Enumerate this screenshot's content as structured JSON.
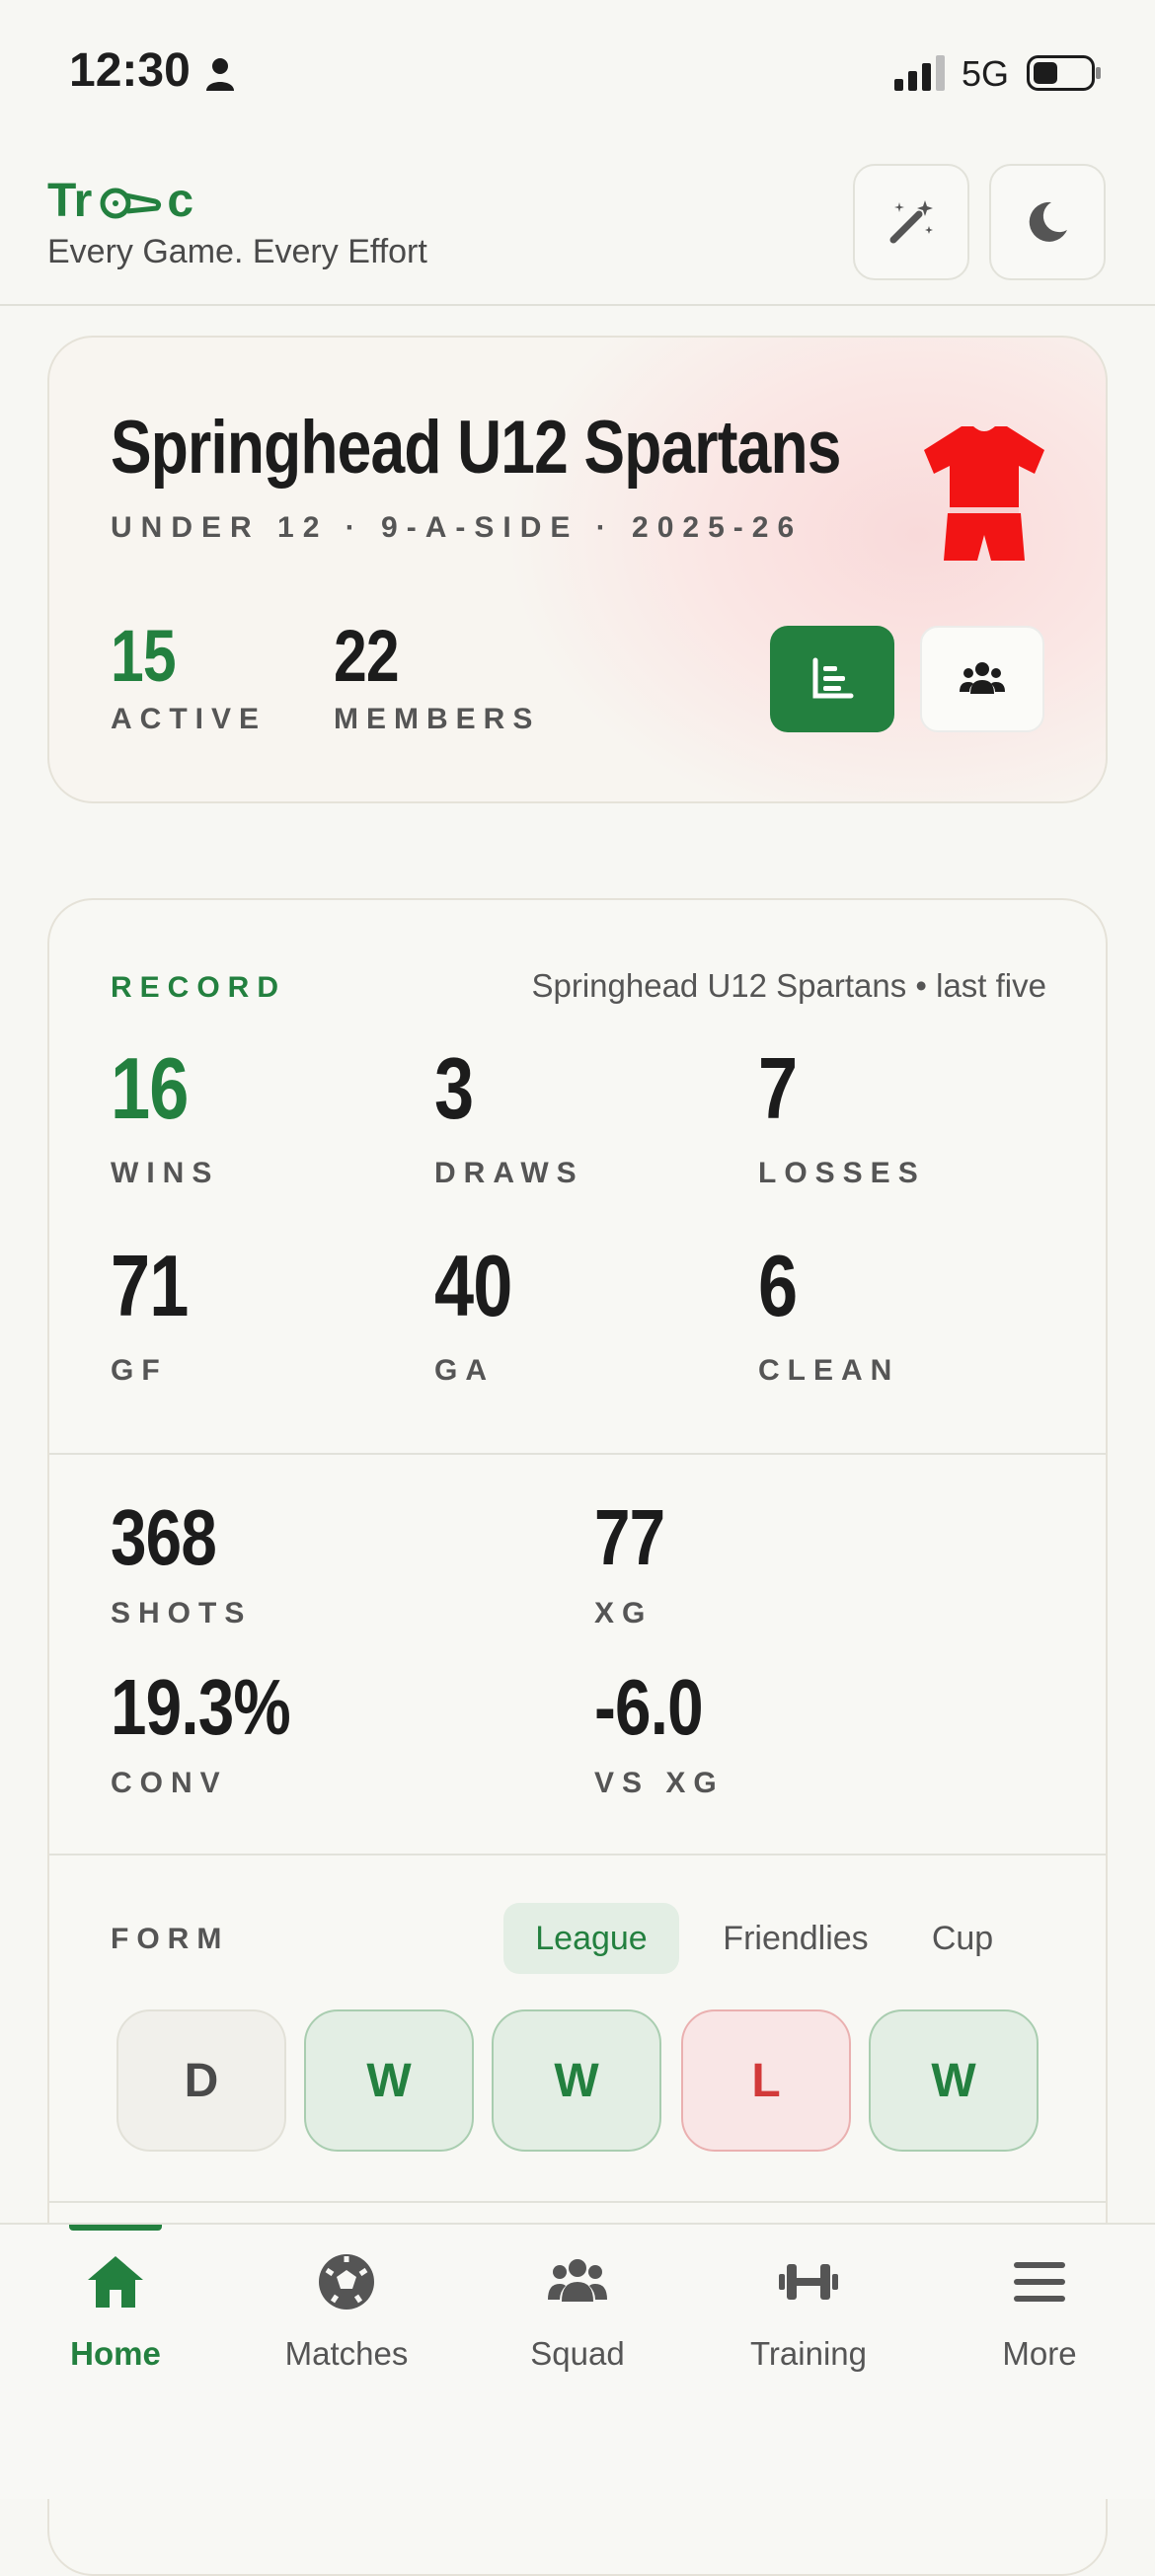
{
  "status_bar": {
    "time": "12:30",
    "network": "5G"
  },
  "header": {
    "logo_pre": "Tr",
    "logo_post": "c",
    "tagline": "Every Game. Every Effort"
  },
  "team": {
    "name": "Springhead U12 Spartans",
    "meta": "UNDER 12 · 9-A-SIDE · 2025-26",
    "active_value": "15",
    "active_label": "ACTIVE",
    "members_value": "22",
    "members_label": "MEMBERS",
    "kit_color": "#f21414"
  },
  "record": {
    "label": "RECORD",
    "subtitle": "Springhead U12 Spartans • last five",
    "stats": [
      {
        "value": "16",
        "label": "WINS"
      },
      {
        "value": "3",
        "label": "DRAWS"
      },
      {
        "value": "7",
        "label": "LOSSES"
      },
      {
        "value": "71",
        "label": "GF"
      },
      {
        "value": "40",
        "label": "GA"
      },
      {
        "value": "6",
        "label": "CLEAN"
      }
    ]
  },
  "shooting": {
    "stats": [
      {
        "value": "368",
        "label": "SHOTS"
      },
      {
        "value": "77",
        "label": "XG"
      },
      {
        "value": "19.3%",
        "label": "CONV"
      },
      {
        "value": "-6.0",
        "label": "VS XG"
      }
    ]
  },
  "form": {
    "label": "FORM",
    "tabs": [
      "League",
      "Friendlies",
      "Cup"
    ],
    "active_tab": "League",
    "results": [
      "D",
      "W",
      "W",
      "L",
      "W"
    ]
  },
  "nav": {
    "items": [
      {
        "label": "Home",
        "icon": "home-icon"
      },
      {
        "label": "Matches",
        "icon": "soccer-ball-icon"
      },
      {
        "label": "Squad",
        "icon": "users-icon"
      },
      {
        "label": "Training",
        "icon": "dumbbell-icon"
      },
      {
        "label": "More",
        "icon": "menu-icon"
      }
    ],
    "active": "Home"
  },
  "colors": {
    "accent": "#23803f",
    "win_bg": "#e3eee4",
    "loss_bg": "#f9e6e6",
    "loss_text": "#d23a3a"
  }
}
